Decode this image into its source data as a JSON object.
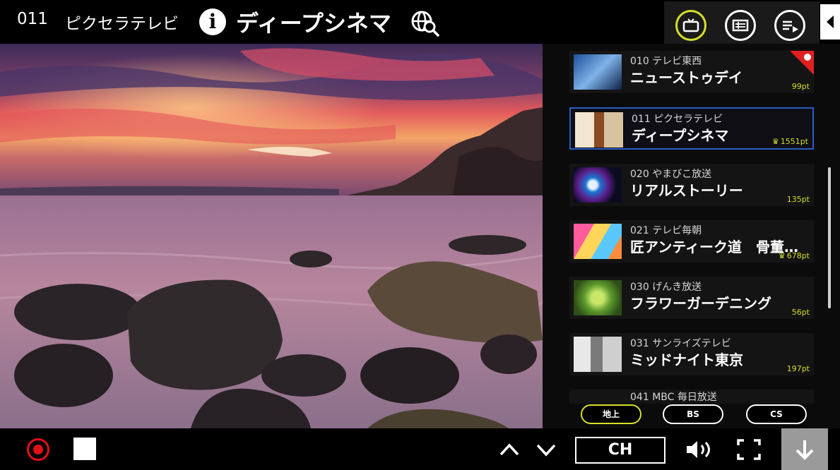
{
  "header": {
    "channel_number": "011",
    "station_name": "ピクセラテレビ",
    "program_title": "ディープシネマ",
    "icons": [
      "info-icon",
      "globe-search-icon",
      "tv-icon",
      "guide-icon",
      "playlist-icon",
      "collapse-arrow-icon"
    ]
  },
  "channels": [
    {
      "number": "010",
      "station": "テレビ東西",
      "title": "ニューストゥデイ",
      "points": "99pt",
      "crown": false,
      "badge": true
    },
    {
      "number": "011",
      "station": "ピクセラテレビ",
      "title": "ディープシネマ",
      "points": "1551pt",
      "crown": true,
      "badge": false,
      "selected": true
    },
    {
      "number": "020",
      "station": "やまびこ放送",
      "title": "リアルストーリー",
      "points": "135pt",
      "crown": false,
      "badge": false
    },
    {
      "number": "021",
      "station": "テレビ毎朝",
      "title": "匠アンティーク道　骨董…",
      "points": "678pt",
      "crown": true,
      "badge": false
    },
    {
      "number": "030",
      "station": "げんき放送",
      "title": "フラワーガーデニング",
      "points": "56pt",
      "crown": false,
      "badge": false
    },
    {
      "number": "031",
      "station": "サンライズテレビ",
      "title": "ミッドナイト東京",
      "points": "197pt",
      "crown": false,
      "badge": false
    },
    {
      "number": "041",
      "station": "MBC 毎日放送",
      "title": "",
      "points": "",
      "crown": false,
      "badge": false
    }
  ],
  "bands": {
    "terrestrial": "地上",
    "bs": "BS",
    "cs": "CS"
  },
  "controls": {
    "ch_label": "CH"
  },
  "colors": {
    "accent": "#d6df2b",
    "record": "#e0101a",
    "selected_border": "#2b5cc5"
  }
}
